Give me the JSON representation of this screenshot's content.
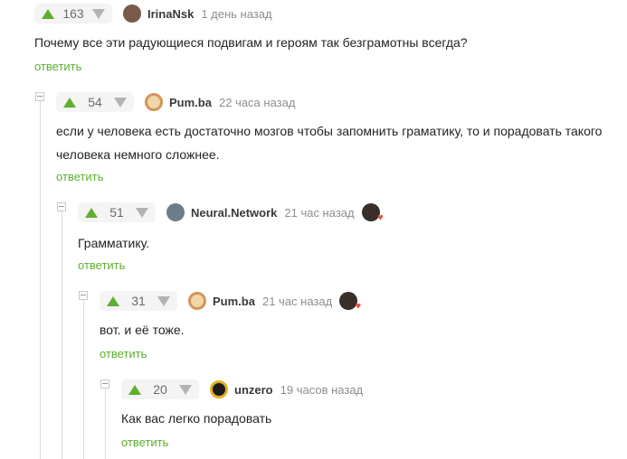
{
  "comments": [
    {
      "score": "163",
      "author": "IrinaNsk",
      "time": "1 день назад",
      "text": "Почему все эти радующиеся подвигам и героям так безграмотны всегда?",
      "reply": "ответить",
      "avatar_color": "#7a5a4a"
    },
    {
      "score": "54",
      "author": "Pum.ba",
      "time": "22 часа назад",
      "text": "если у человека есть достаточно мозгов чтобы запомнить граматику, то и порадовать такого человека немного сложнее.",
      "reply": "ответить",
      "avatar_color": "#d4955a"
    },
    {
      "score": "51",
      "author": "Neural.Network",
      "time": "21 час назад",
      "text": "Грамматику.",
      "reply": "ответить",
      "avatar_color": "#6d7d8a"
    },
    {
      "score": "31",
      "author": "Pum.ba",
      "time": "21 час назад",
      "text": "вот. и её тоже.",
      "reply": "ответить",
      "avatar_color": "#d4955a"
    },
    {
      "score": "20",
      "author": "unzero",
      "time": "19 часов назад",
      "text": "Как вас легко порадовать",
      "reply": "ответить",
      "avatar_color": "#1c1c1c"
    }
  ],
  "colors": {
    "accent": "#5eae2f",
    "heart": "#e8503a"
  }
}
